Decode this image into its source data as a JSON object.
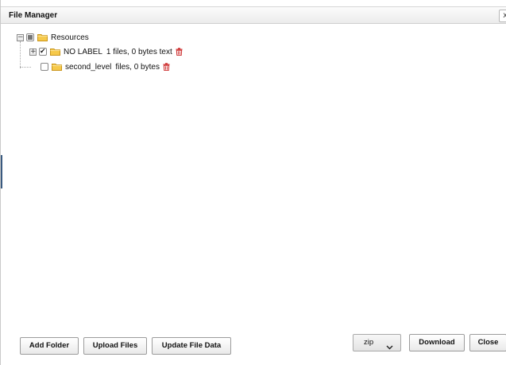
{
  "window": {
    "title": "File Manager",
    "close_glyph": "x"
  },
  "tree": {
    "root": {
      "expander": "−",
      "checkbox": "partial",
      "icon": "folder-icon",
      "label": "Resources"
    },
    "children": [
      {
        "expander": "+",
        "checkbox": "checked",
        "icon": "folder-icon",
        "label": "NO LABEL",
        "meta": "1 files, 0 bytes text",
        "action_icon": "trash-icon"
      },
      {
        "checkbox": "unchecked",
        "icon": "folder-icon",
        "label": "second_level",
        "meta": "files, 0 bytes",
        "action_icon": "trash-icon"
      }
    ]
  },
  "footer": {
    "add_folder_label": "Add Folder",
    "upload_files_label": "Upload Files",
    "update_file_data_label": "Update File Data",
    "format_select": {
      "value": "zip"
    },
    "download_label": "Download",
    "close_label": "Close"
  },
  "colors": {
    "folder_fill": "#f6c94a",
    "folder_stroke": "#c9951a",
    "trash": "#cc2b2b"
  }
}
